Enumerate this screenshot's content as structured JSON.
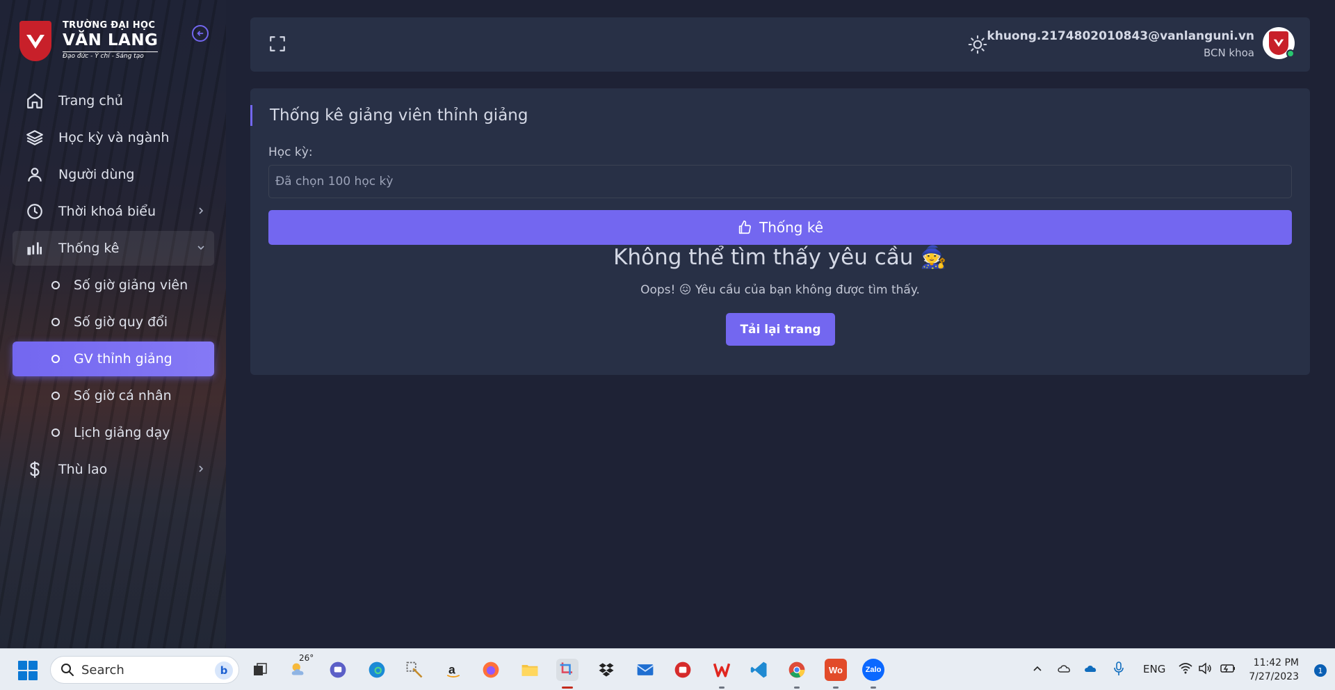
{
  "brand": {
    "line1": "TRƯỜNG ĐẠI HỌC",
    "line2": "VĂN LANG",
    "motto": "Đạo đức - Ý chí - Sáng tạo"
  },
  "sidebar": {
    "items": [
      {
        "label": "Trang chủ",
        "icon": "home-icon"
      },
      {
        "label": "Học kỳ và ngành",
        "icon": "layers-icon"
      },
      {
        "label": "Người dùng",
        "icon": "user-icon"
      },
      {
        "label": "Thời khoá biểu",
        "icon": "clock-icon",
        "has_children": true
      },
      {
        "label": "Thống kê",
        "icon": "bar-chart-icon",
        "expanded": true
      },
      {
        "label": "Thù lao",
        "icon": "dollar-icon",
        "has_children": true
      }
    ],
    "stats_subitems": [
      {
        "label": "Số giờ giảng viên"
      },
      {
        "label": "Số giờ quy đổi"
      },
      {
        "label": "GV thỉnh giảng",
        "active": true
      },
      {
        "label": "Số giờ cá nhân"
      },
      {
        "label": "Lịch giảng dạy"
      }
    ]
  },
  "header": {
    "user_email": "khuong.2174802010843@vanlanguni.vn",
    "user_role": "BCN khoa"
  },
  "main": {
    "title": "Thống kê giảng viên thỉnh giảng",
    "semester_label": "Học kỳ:",
    "semester_value": "Đã chọn 100 học kỳ",
    "stat_button": "Thống kê",
    "error_title": "Không thể tìm thấy yêu cầu 🧙",
    "error_message": "Oops! 😖 Yêu cầu của bạn không được tìm thấy.",
    "reload_button": "Tải lại trang"
  },
  "taskbar": {
    "search_placeholder": "Search",
    "weather_temp": "26°",
    "language": "ENG",
    "time": "11:42 PM",
    "date": "7/27/2023",
    "notification_count": "1"
  },
  "colors": {
    "accent": "#7367f0",
    "card": "#283046",
    "background": "#1e2235",
    "brand_red": "#c8202a"
  }
}
